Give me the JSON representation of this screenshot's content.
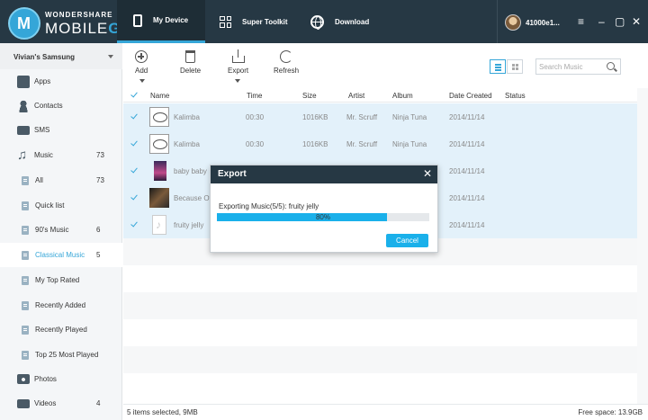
{
  "app": {
    "brand_top": "WONDERSHARE",
    "brand_bottom_a": "MOBILE",
    "brand_bottom_b": "GO"
  },
  "nav": {
    "tabs": [
      {
        "label": "My Device",
        "active": true
      },
      {
        "label": "Super Toolkit"
      },
      {
        "label": "Download"
      }
    ]
  },
  "account": {
    "name": "41000e1..."
  },
  "window": {
    "menu": "≡",
    "minimize": "–",
    "restore": "▢",
    "close": "✕"
  },
  "sidebar": {
    "device": "Vivian's Samsung",
    "items": [
      {
        "label": "Apps"
      },
      {
        "label": "Contacts"
      },
      {
        "label": "SMS"
      },
      {
        "label": "Music",
        "count": "73"
      },
      {
        "label": "All",
        "count": "73"
      },
      {
        "label": "Quick list"
      },
      {
        "label": "90's Music",
        "count": "6"
      },
      {
        "label": "Classical Music",
        "count": "5",
        "active": true
      },
      {
        "label": "My Top Rated"
      },
      {
        "label": "Recently Added"
      },
      {
        "label": "Recently Played"
      },
      {
        "label": "Top 25 Most Played"
      },
      {
        "label": "Photos"
      },
      {
        "label": "Videos",
        "count": "4"
      }
    ]
  },
  "toolbar": {
    "add": "Add",
    "delete": "Delete",
    "export": "Export",
    "refresh": "Refresh",
    "search_placeholder": "Search Music"
  },
  "table": {
    "columns": [
      "Name",
      "Time",
      "Size",
      "Artist",
      "Album",
      "Date Created",
      "Status"
    ],
    "rows": [
      {
        "name": "Kalimba",
        "time": "00:30",
        "size": "1016KB",
        "artist": "Mr. Scruff",
        "album": "Ninja Tuna",
        "date": "2014/11/14"
      },
      {
        "name": "Kalimba",
        "time": "00:30",
        "size": "1016KB",
        "artist": "Mr. Scruff",
        "album": "Ninja Tuna",
        "date": "2014/11/14"
      },
      {
        "name": "baby baby",
        "time": "",
        "size": "",
        "artist": "",
        "album": "",
        "date": "2014/11/14"
      },
      {
        "name": "Because Of Y",
        "time": "",
        "size": "",
        "artist": "",
        "album": "",
        "date": "2014/11/14"
      },
      {
        "name": "fruity jelly",
        "time": "",
        "size": "",
        "artist": "",
        "album": "",
        "date": "2014/11/14"
      }
    ]
  },
  "status": {
    "selected": "5  items selected, 9MB",
    "free": "Free space: 13.9GB"
  },
  "dialog": {
    "title": "Export",
    "close": "✕",
    "message": "Exporting Music(5/5): fruity jelly",
    "progress": 80,
    "progress_label": "80%",
    "cancel": "Cancel"
  },
  "colors": {
    "titlebar": "#263844",
    "accent": "#35a6d8",
    "progress": "#1ab0ea",
    "selected_row": "#e3f1fa"
  }
}
